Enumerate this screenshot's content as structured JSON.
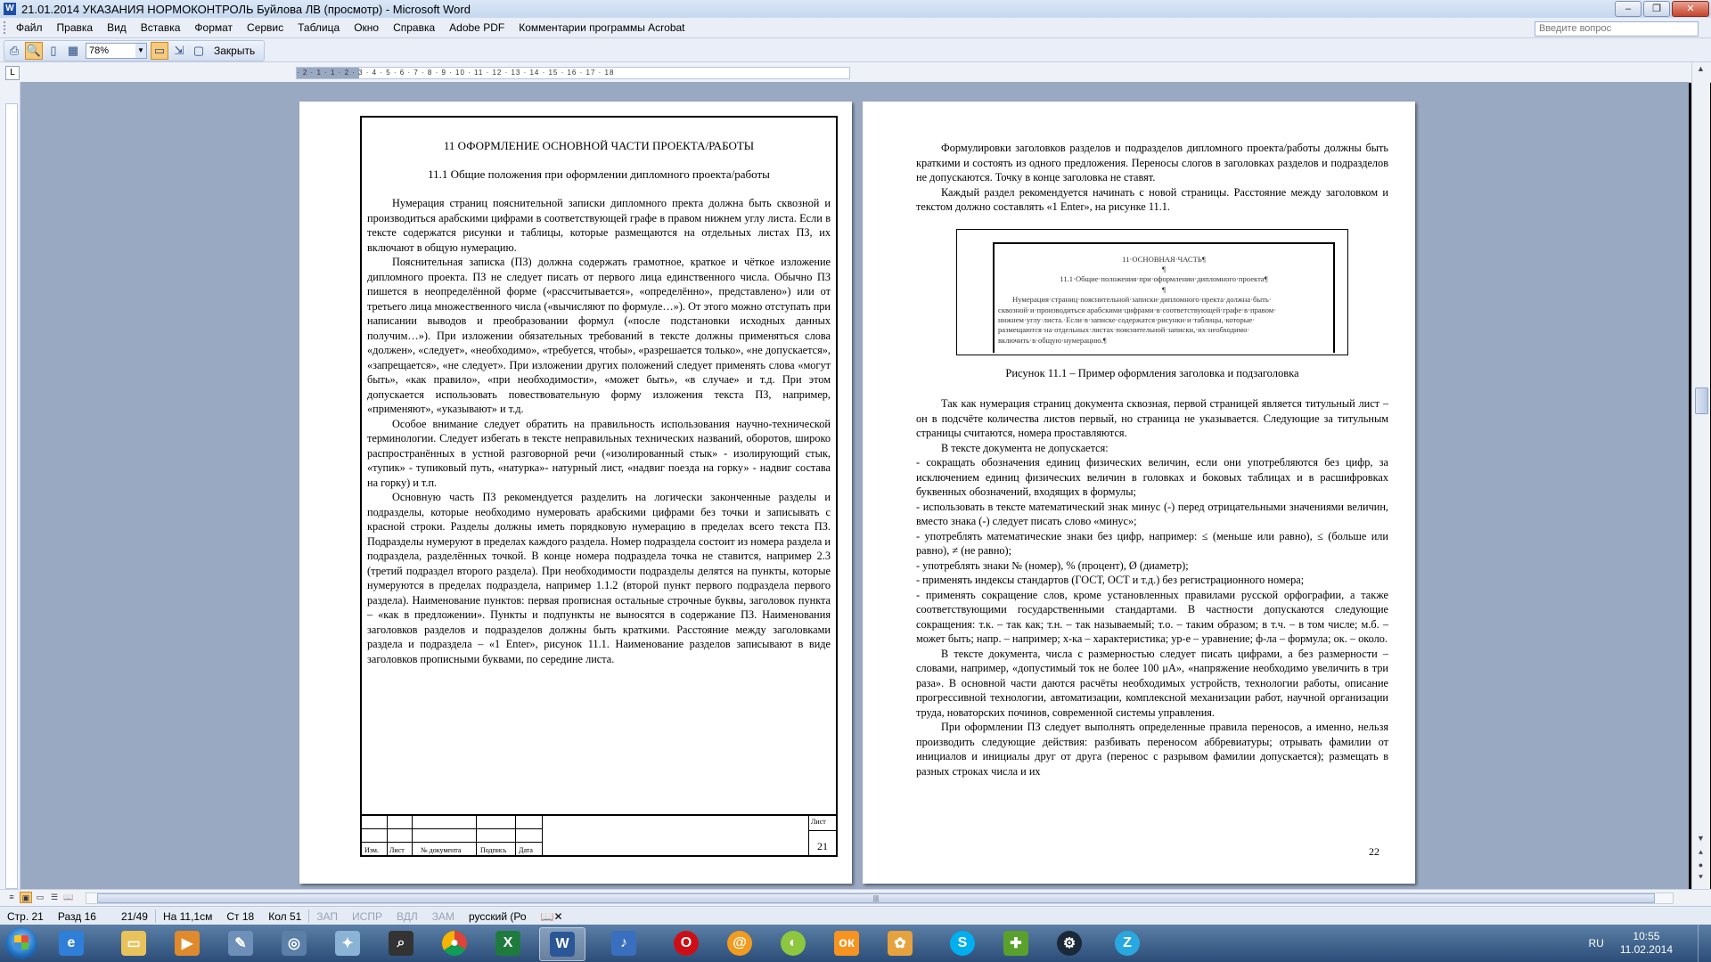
{
  "window": {
    "title": "21.01.2014 УКАЗАНИЯ НОРМОКОНТРОЛЬ Буйлова ЛВ (просмотр) - Microsoft Word"
  },
  "menu": {
    "items": [
      "Файл",
      "Правка",
      "Вид",
      "Вставка",
      "Формат",
      "Сервис",
      "Таблица",
      "Окно",
      "Справка",
      "Adobe PDF",
      "Комментарии программы Acrobat"
    ],
    "help_placeholder": "Введите вопрос"
  },
  "toolbar": {
    "zoom": "78%",
    "close_label": "Закрыть"
  },
  "ruler": {
    "marks": "· 2 · 1 · 1 · 2 · 3 · 4 · 5 · 6 · 7 · 8 · 9 · 10 · 11 · 12 · 13 · 14 · 15 · 16 · 17 · 18"
  },
  "page21": {
    "heading1": "11 ОФОРМЛЕНИЕ ОСНОВНОЙ ЧАСТИ ПРОЕКТА/РАБОТЫ",
    "heading2": "11.1 Общие положения при оформлении дипломного проекта/работы",
    "paragraphs": [
      "Нумерация страниц пояснительной записки дипломного пректа должна быть сквозной и производиться арабскими цифрами в соответствующей графе в правом нижнем углу листа. Если в тексте содержатся рисунки и таблицы, которые размещаются на отдельных листах ПЗ, их включают в общую нумерацию.",
      "Пояснительная записка (ПЗ) должна содержать грамотное, краткое и чёткое изложение дипломного проекта. ПЗ не следует писать от первого лица единственного числа. Обычно ПЗ пишется в неопределённой форме («рассчитывается», «определённо», представлено») или от третьего лица множественного числа («вычисляют по формуле…»). От этого можно отступать при написании выводов и преобразовании формул («после подстановки исходных данных получим…»). При изложении обязательных требований в тексте должны применяться слова «должен», «следует», «необходимо», «требуется, чтобы», «разрешается только», «не допускается», «запрещается», «не следует». При изложении других положений следует применять слова «могут быть», «как правило», «при необходимости», «может быть», «в случае» и т.д. При этом допускается использовать повествовательную форму изложения текста ПЗ, например, «применяют», «указывают» и т.д.",
      "Особое внимание следует обратить на правильность использования научно-технической терминологии. Следует избегать в тексте неправильных технических названий, оборотов, широко распространённых в устной разговорной речи («изолированный стык» - изолирующий стык, «тупик» - тупиковый путь, «натурка»- натурный лист, «надвиг поезда на горку» - надвиг состава на горку) и т.п.",
      "Основную часть ПЗ рекомендуется разделить на логически законченные разделы и подразделы, которые необходимо нумеровать арабскими цифрами без точки и записывать с красной строки. Разделы должны иметь порядковую нумерацию в пределах всего текста ПЗ. Подразделы нумеруют в пределах каждого раздела. Номер подраздела состоит из номера раздела и подраздела, разделённых точкой. В конце номера подраздела точка не ставится, например 2.3 (третий подраздел второго раздела). При необходимости подразделы делятся на пункты, которые нумеруются в пределах подраздела, например 1.1.2 (второй пункт первого подраздела первого раздела). Наименование пунктов: первая прописная остальные строчные буквы, заголовок пункта – «как в предложении». Пункты и подпункты не выносятся в содержание ПЗ. Наименования заголовков разделов и подразделов должны быть краткими. Расстояние между заголовками раздела и подраздела – «1 Enter», рисунок 11.1. Наименование разделов записывают в виде заголовков прописными буквами, по середине листа."
    ],
    "stamp": {
      "col_izm": "Изм.",
      "col_list": "Лист",
      "col_doc": "№ документа",
      "col_podp": "Подпись",
      "col_date": "Дата",
      "list_label": "Лист",
      "page_number": "21"
    }
  },
  "page22": {
    "paragraphs_top": [
      "Формулировки заголовков разделов и подразделов дипломного проекта/работы должны быть краткими и состоять из одного предложения. Переносы слогов в заголовках разделов и подразделов не допускаются. Точку в конце заголовка не ставят.",
      "Каждый раздел рекомендуется начинать с новой страницы. Расстояние между заголовком и текстом должно составлять «1 Enter», на рисунке 11.1."
    ],
    "figure": {
      "line1": "11·ОСНОВНАЯ·ЧАСТЬ¶",
      "pilcrow": "¶",
      "line2": "11.1·Общие·положения·при·оформлении·дипломного·проекта¶",
      "body": "Нумерация·страниц·пояснительной·записки·дипломного·пректа·должна·быть· сквозной·и·производиться·арабскими·цифрами·в·соответствующей·графе·в·правом· нижнем·углу·листа.·Если·в·записке·содержатся·рисунки·и·таблицы,·которые· размещаются·на·отдельных·листах·пояснительной·записки,·их·необходимо· включить·в·общую·нумерацию.¶"
    },
    "caption": "Рисунок 11.1 – Пример оформления заголовка и подзаголовка",
    "paragraphs_bottom": [
      {
        "indent": true,
        "text": "Так как нумерация страниц документа сквозная, первой страницей является титульный лист – он в подсчёте количества листов первый, но страница не указывается. Следующие за титульным страницы считаются, номера проставляются."
      },
      {
        "indent": true,
        "text": "В тексте документа не допускается:"
      },
      {
        "indent": false,
        "text": "- сокращать обозначения единиц физических величин, если они употребляются без цифр, за исключением единиц физических величин в головках и боковых таблицах и в расшифровках буквенных обозначений, входящих в формулы;"
      },
      {
        "indent": false,
        "text": "- использовать в тексте математический знак минус (-) перед отрицательными значениями величин, вместо знака (-) следует писать слово «минус»;"
      },
      {
        "indent": false,
        "text": "- употреблять математические знаки без цифр, например: ≤ (меньше или равно), ≤ (больше или равно), ≠ (не равно);"
      },
      {
        "indent": false,
        "text": "- употреблять знаки № (номер), % (процент), Ø (диаметр);"
      },
      {
        "indent": false,
        "text": "- применять индексы стандартов (ГОСТ, ОСТ и т.д.) без регистрационного номера;"
      },
      {
        "indent": false,
        "text": "- применять сокращение слов, кроме установленных правилами русской орфографии, а также соответствующими государственными стандартами. В частности допускаются следующие сокращения: т.к. – так как; т.н. – так называемый; т.о. – таким образом; в т.ч. – в том числе; м.б. – может быть; напр. – например; х-ка – характеристика; ур-е – уравнение; ф-ла – формула; ок. – около."
      },
      {
        "indent": true,
        "text": "В тексте документа, числа с размерностью следует писать цифрами, а без размерности – словами, например, «допустимый ток не более 100 μА», «напряжение необходимо увеличить в три раза». В основной части даются расчёты необходимых устройств, технологии работы, описание прогрессивной технологии, автоматизации, комплексной механизации работ, научной организации труда, новаторских починов, современной системы управления."
      },
      {
        "indent": true,
        "text": "При оформлении ПЗ следует выполнять определенные правила переносов, а именно, нельзя производить следующие действия: разбивать переносом аббревиатуры; отрывать фамилии от инициалов и инициалы друг от друга (перенос с разрывом фамилии допускается); размещать в разных строках числа и их"
      }
    ],
    "page_number": "22"
  },
  "statusbar": {
    "page": "Стр. 21",
    "section": "Разд 16",
    "pages": "21/49",
    "at": "На 11,1см",
    "line": "Ст 18",
    "col": "Кол 51",
    "rec": "ЗАП",
    "trk": "ИСПР",
    "ext": "ВДЛ",
    "ovr": "ЗАМ",
    "lang": "русский (Ро"
  },
  "taskbar": {
    "apps": [
      "explorer-icon",
      "ie-icon",
      "media-player-icon",
      "tools-icon",
      "maps-icon",
      "settings-icon",
      "search-icon",
      "chrome-icon",
      "excel-icon",
      "word-icon",
      "audio-icon",
      "opera-icon",
      "mail-agent-icon",
      "cloud-icon",
      "odnoklassniki-icon",
      "paint-icon",
      "skype-icon",
      "games-icon",
      "steam-icon",
      "z-icon"
    ],
    "lang": "RU",
    "time": "10:55",
    "date": "11.02.2014"
  }
}
